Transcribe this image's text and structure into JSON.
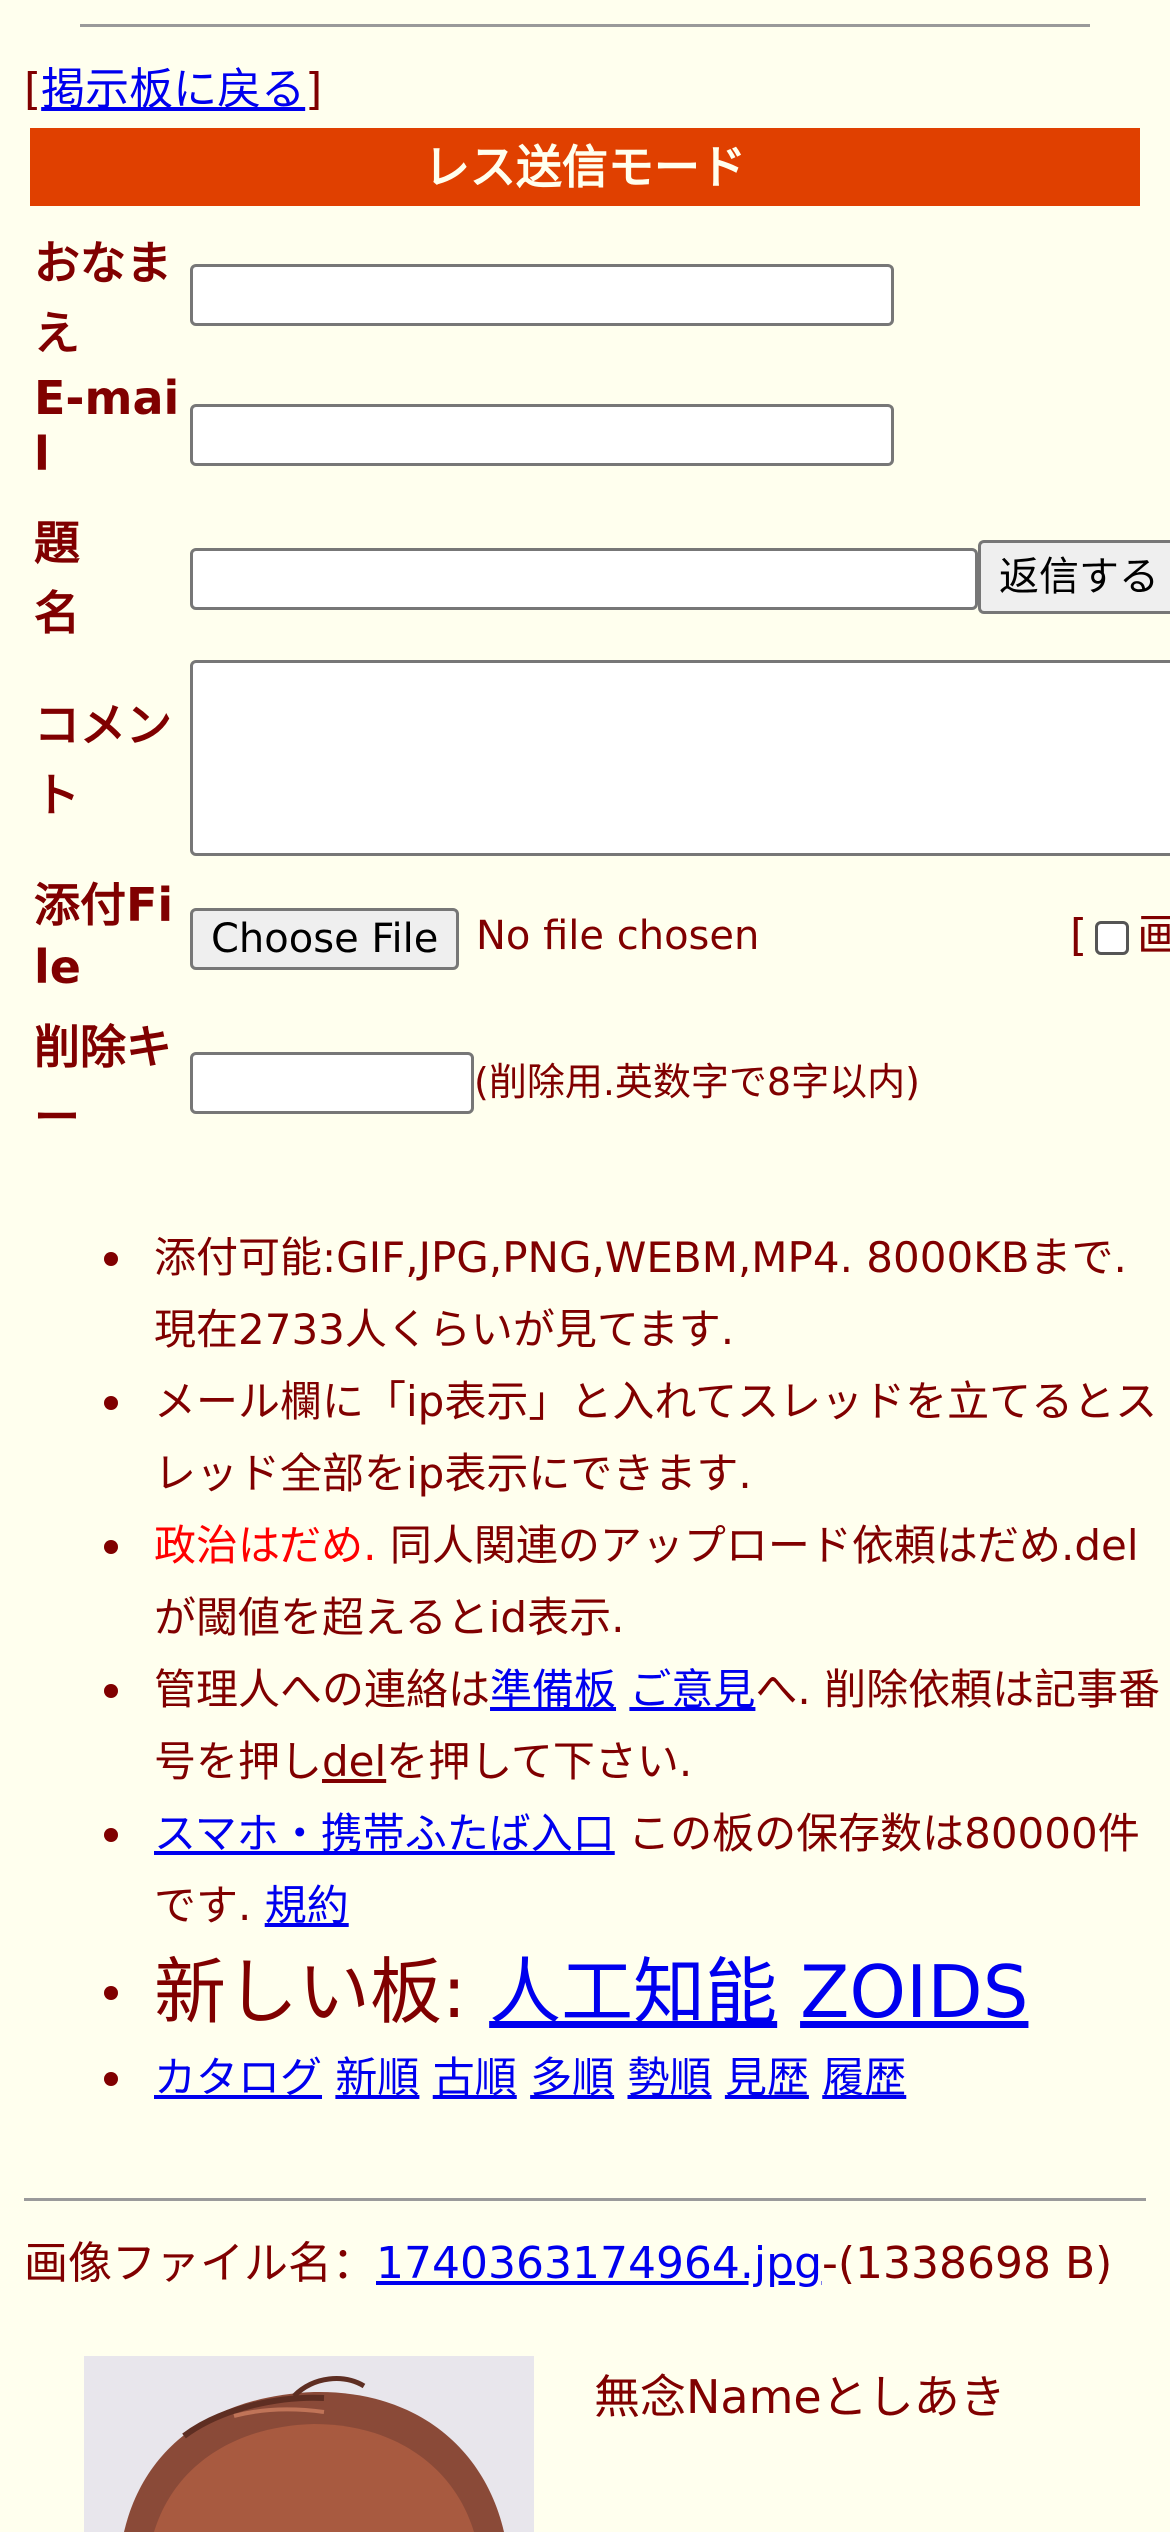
{
  "nav": {
    "bracket_open": "[",
    "back_link": "掲示板に戻る",
    "bracket_close": "]"
  },
  "form": {
    "header": "レス送信モード",
    "name_label": "おなまえ",
    "email_label": "E-mail",
    "subject_label": "題名",
    "submit_button": "返信する",
    "comment_label": "コメント",
    "file_label": "添付File",
    "choose_file_button": "Choose File",
    "no_file_text": "No file chosen",
    "image_check_bracket": "[",
    "image_check_label": "画",
    "delete_key_label": "削除キー",
    "delete_key_note": "(削除用.英数字で8字以内)"
  },
  "rules": {
    "item1": "添付可能:GIF,JPG,PNG,WEBM,MP4. 8000KBまで. 現在2733人くらいが見てます.",
    "item2": "メール欄に「ip表示」と入れてスレッドを立てるとスレッド全部をip表示にできます.",
    "item3_red": "政治はだめ.",
    "item3_rest": " 同人関連のアップロード依頼はだめ.delが閾値を超えるとid表示.",
    "item4_pre": "管理人への連絡は",
    "item4_link1": "準備板",
    "item4_link2": "ご意見",
    "item4_mid": "へ. 削除依頼は記事番号を押し",
    "item4_del": "del",
    "item4_post": "を押して下さい.",
    "item5_link": "スマホ・携帯ふたば入口",
    "item5_text": " この板の保存数は80000件です. ",
    "item5_terms": "規約",
    "item6_label": "新しい板: ",
    "item6_link1": "人工知能",
    "item6_link2": "ZOIDS",
    "sort_links": [
      "カタログ",
      "新順",
      "古順",
      "多順",
      "勢順",
      "見歴",
      "履歴"
    ]
  },
  "post": {
    "file_prefix": "画像ファイル名：",
    "file_name": "1740363174964.jpg",
    "file_size": "-(1338698 B)",
    "poster": "無念Nameとしあき"
  },
  "colors": {
    "background": "#ffffee",
    "text": "#800000",
    "header_bar": "#e04000",
    "link": "#0000ee",
    "warning": "#ff0000"
  }
}
